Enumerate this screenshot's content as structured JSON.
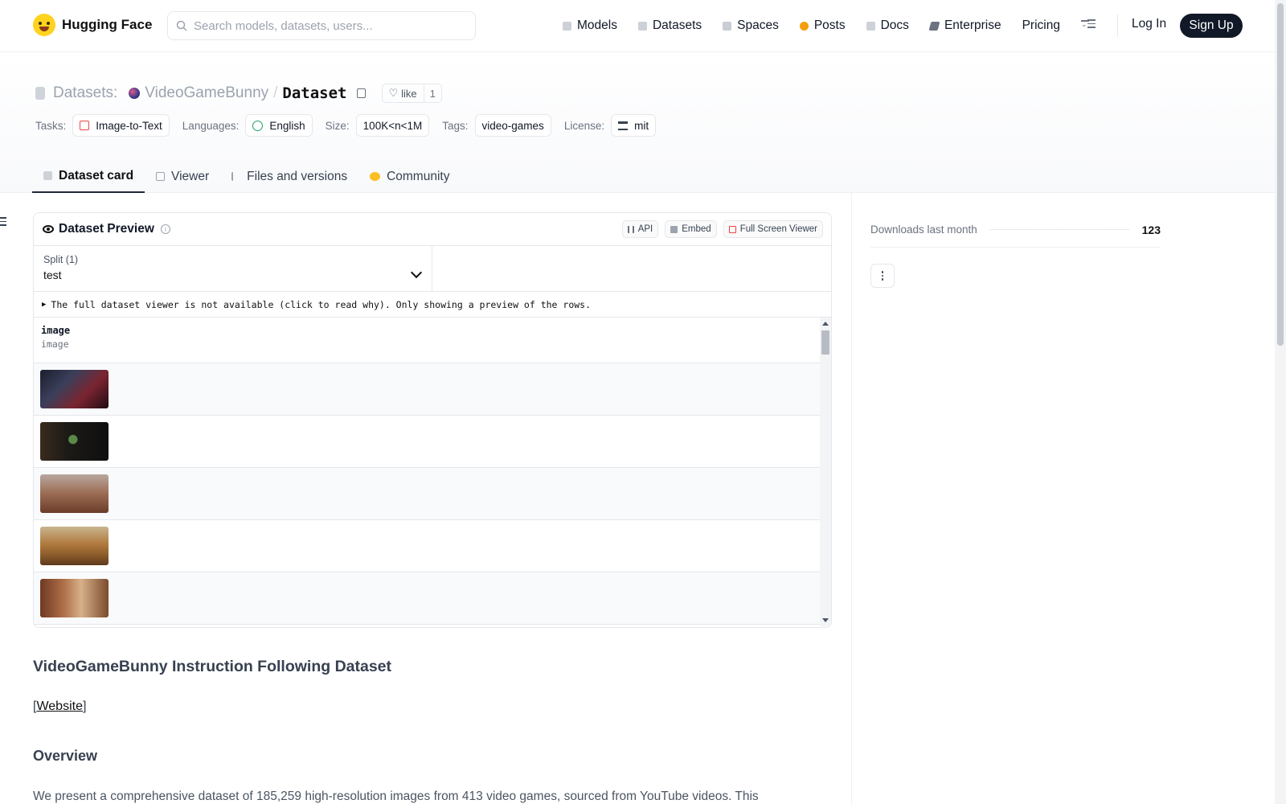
{
  "brand": {
    "name": "Hugging Face"
  },
  "search": {
    "placeholder": "Search models, datasets, users..."
  },
  "nav": {
    "items": [
      {
        "label": "Models",
        "icon": "cube-icon"
      },
      {
        "label": "Datasets",
        "icon": "database-icon"
      },
      {
        "label": "Spaces",
        "icon": "grid-icon"
      },
      {
        "label": "Posts",
        "icon": "chat-bubble-icon"
      },
      {
        "label": "Docs",
        "icon": "document-icon"
      },
      {
        "label": "Enterprise",
        "icon": "building-icon"
      },
      {
        "label": "Pricing",
        "icon": ""
      }
    ],
    "login": "Log In",
    "signup": "Sign Up"
  },
  "breadcrumb": {
    "section": "Datasets:",
    "org": "VideoGameBunny",
    "separator": "/",
    "name": "Dataset"
  },
  "like": {
    "label": "like",
    "count": "1"
  },
  "tags": {
    "tasks_label": "Tasks:",
    "task": "Image-to-Text",
    "languages_label": "Languages:",
    "language": "English",
    "size_label": "Size:",
    "size": "100K<n<1M",
    "tags_label": "Tags:",
    "tag": "video-games",
    "license_label": "License:",
    "license": "mit"
  },
  "tabs": [
    {
      "label": "Dataset card",
      "active": true
    },
    {
      "label": "Viewer",
      "active": false
    },
    {
      "label": "Files and versions",
      "active": false
    },
    {
      "label": "Community",
      "active": false
    }
  ],
  "preview": {
    "title": "Dataset Preview",
    "actions": {
      "api": "API",
      "embed": "Embed",
      "fullscreen": "Full Screen Viewer"
    },
    "split_label": "Split (1)",
    "split_value": "test",
    "notice": "The full dataset viewer is not available (click to read why). Only showing a preview of the rows.",
    "column": {
      "name": "image",
      "type": "image"
    },
    "rows": [
      {
        "thumbnail": "sci-fi-armored-character"
      },
      {
        "thumbnail": "game-inventory-menu"
      },
      {
        "thumbnail": "desert-creature-scene"
      },
      {
        "thumbnail": "vehicle-in-autumn-field"
      },
      {
        "thumbnail": "two-characters-forest"
      }
    ]
  },
  "doc": {
    "heading": "VideoGameBunny Instruction Following Dataset",
    "website_open": "[",
    "website_link": "Website",
    "website_close": "]",
    "overview": "Overview",
    "intro": "We present a comprehensive dataset of 185,259 high-resolution images from 413 video games, sourced from YouTube videos. This"
  },
  "sidebar": {
    "downloads_label": "Downloads last month",
    "downloads_value": "123"
  }
}
